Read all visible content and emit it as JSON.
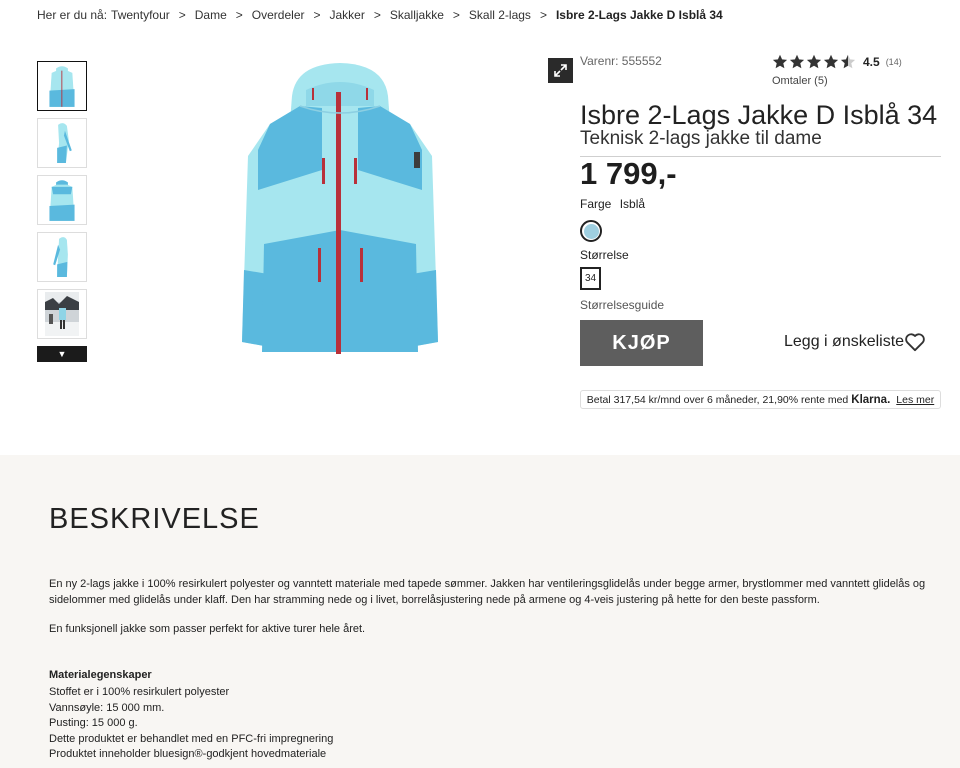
{
  "breadcrumb": {
    "prefix": "Her er du nå:",
    "items": [
      "Twentyfour",
      "Dame",
      "Overdeler",
      "Jakker",
      "Skalljakke",
      "Skall 2-lags"
    ],
    "current": "Isbre 2-Lags Jakke D Isblå 34",
    "separator": ">"
  },
  "product": {
    "sku": "Varenr: 555552",
    "rating_value": "4.5",
    "rating_count": "(14)",
    "rating_stars": 4.5,
    "reviews_link": "Omtaler (5)",
    "title": "Isbre 2-Lags Jakke D Isblå 34",
    "subtitle": "Teknisk 2-lags jakke til dame",
    "price": "1 799,-",
    "color_label": "Farge",
    "color_value": "Isblå",
    "swatch_color": "#9fcfe0",
    "size_label": "Størrelse",
    "size_value": "34",
    "size_guide": "Størrelsesguide",
    "buy_label": "KJØP",
    "wishlist_label": "Legg i ønskeliste"
  },
  "klarna": {
    "text": "Betal 317,54 kr/mnd over 6 måneder, 21,90% rente med",
    "logo": "Klarna.",
    "link": "Les mer"
  },
  "description": {
    "title": "BESKRIVELSE",
    "p1": "En ny 2-lags jakke i 100% resirkulert polyester og vanntett materiale med tapede sømmer. Jakken har ventileringsglidelås under begge armer, brystlommer med vanntett glidelås og sidelommer med glidelås under klaff. Den har stramming nede og i livet, borrelåsjustering nede på armene og 4-veis justering på hette for den beste passform.",
    "p2": "En funksjonell jakke som passer perfekt for aktive turer hele året.",
    "materials_title": "Materialegenskaper",
    "materials": [
      "Stoffet er i 100% resirkulert polyester",
      "Vannsøyle: 15 000 mm.",
      "Pusting: 15 000 g.",
      "Dette produktet er behandlet med en PFC-fri impregnering",
      "Produktet inneholder bluesign®-godkjent hovedmateriale"
    ]
  },
  "colors": {
    "jacket_light": "#a6e6ef",
    "jacket_mid": "#5ab9de",
    "zipper": "#b8303a",
    "buy_button": "#5e5e5e",
    "description_bg": "#f8f6f3"
  }
}
